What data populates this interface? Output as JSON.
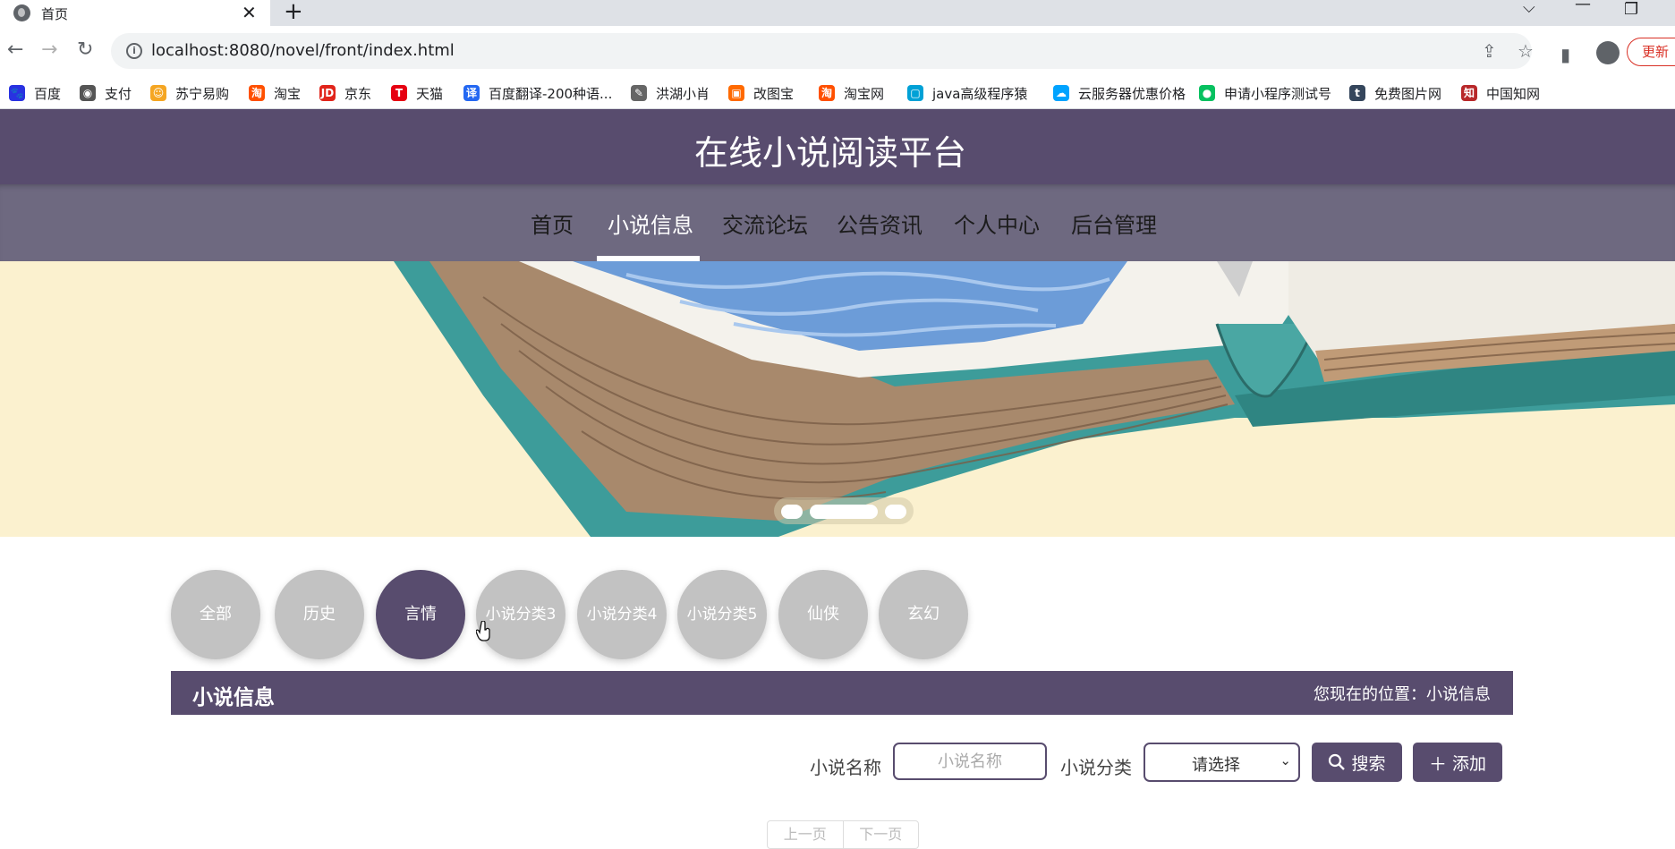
{
  "browser": {
    "tab_title": "首页",
    "url": "localhost:8080/novel/front/index.html",
    "update_label": "更新",
    "bookmarks": [
      {
        "label": "百度",
        "color": "#2932e1"
      },
      {
        "label": "支付",
        "color": "#555555"
      },
      {
        "label": "苏宁易购",
        "color": "#f5a623"
      },
      {
        "label": "淘宝",
        "color": "#ff5000"
      },
      {
        "label": "京东",
        "color": "#e1251b"
      },
      {
        "label": "天猫",
        "color": "#e60012"
      },
      {
        "label": "百度翻译-200种语...",
        "color": "#2468f2"
      },
      {
        "label": "洪湖小肖",
        "color": "#666666"
      },
      {
        "label": "改图宝",
        "color": "#ff6a00"
      },
      {
        "label": "淘宝网",
        "color": "#ff5000"
      },
      {
        "label": "java高级程序猿",
        "color": "#00a1d6"
      },
      {
        "label": "云服务器优惠价格",
        "color": "#00a3ff"
      },
      {
        "label": "申请小程序测试号",
        "color": "#07c160"
      },
      {
        "label": "免费图片网",
        "color": "#35465c"
      },
      {
        "label": "中国知网",
        "color": "#b8282a"
      }
    ]
  },
  "site": {
    "title": "在线小说阅读平台",
    "nav": [
      "首页",
      "小说信息",
      "交流论坛",
      "公告资讯",
      "个人中心",
      "后台管理"
    ],
    "active_nav": "小说信息"
  },
  "categories": [
    "全部",
    "历史",
    "言情",
    "小说分类3",
    "小说分类4",
    "小说分类5",
    "仙侠",
    "玄幻"
  ],
  "active_category": "言情",
  "section": {
    "title": "小说信息",
    "location_prefix": "您现在的位置：",
    "location": "小说信息"
  },
  "search": {
    "name_label": "小说名称",
    "name_placeholder": "小说名称",
    "category_label": "小说分类",
    "category_selected": "请选择",
    "search_button": "搜索",
    "add_button": "添加"
  },
  "pager": {
    "prev": "上一页",
    "next": "下一页"
  },
  "colors": {
    "primary": "#584c6e",
    "nav_bg": "#6e6980",
    "category_inactive": "#c2c2c2",
    "banner_bg": "#fbf1cf"
  }
}
